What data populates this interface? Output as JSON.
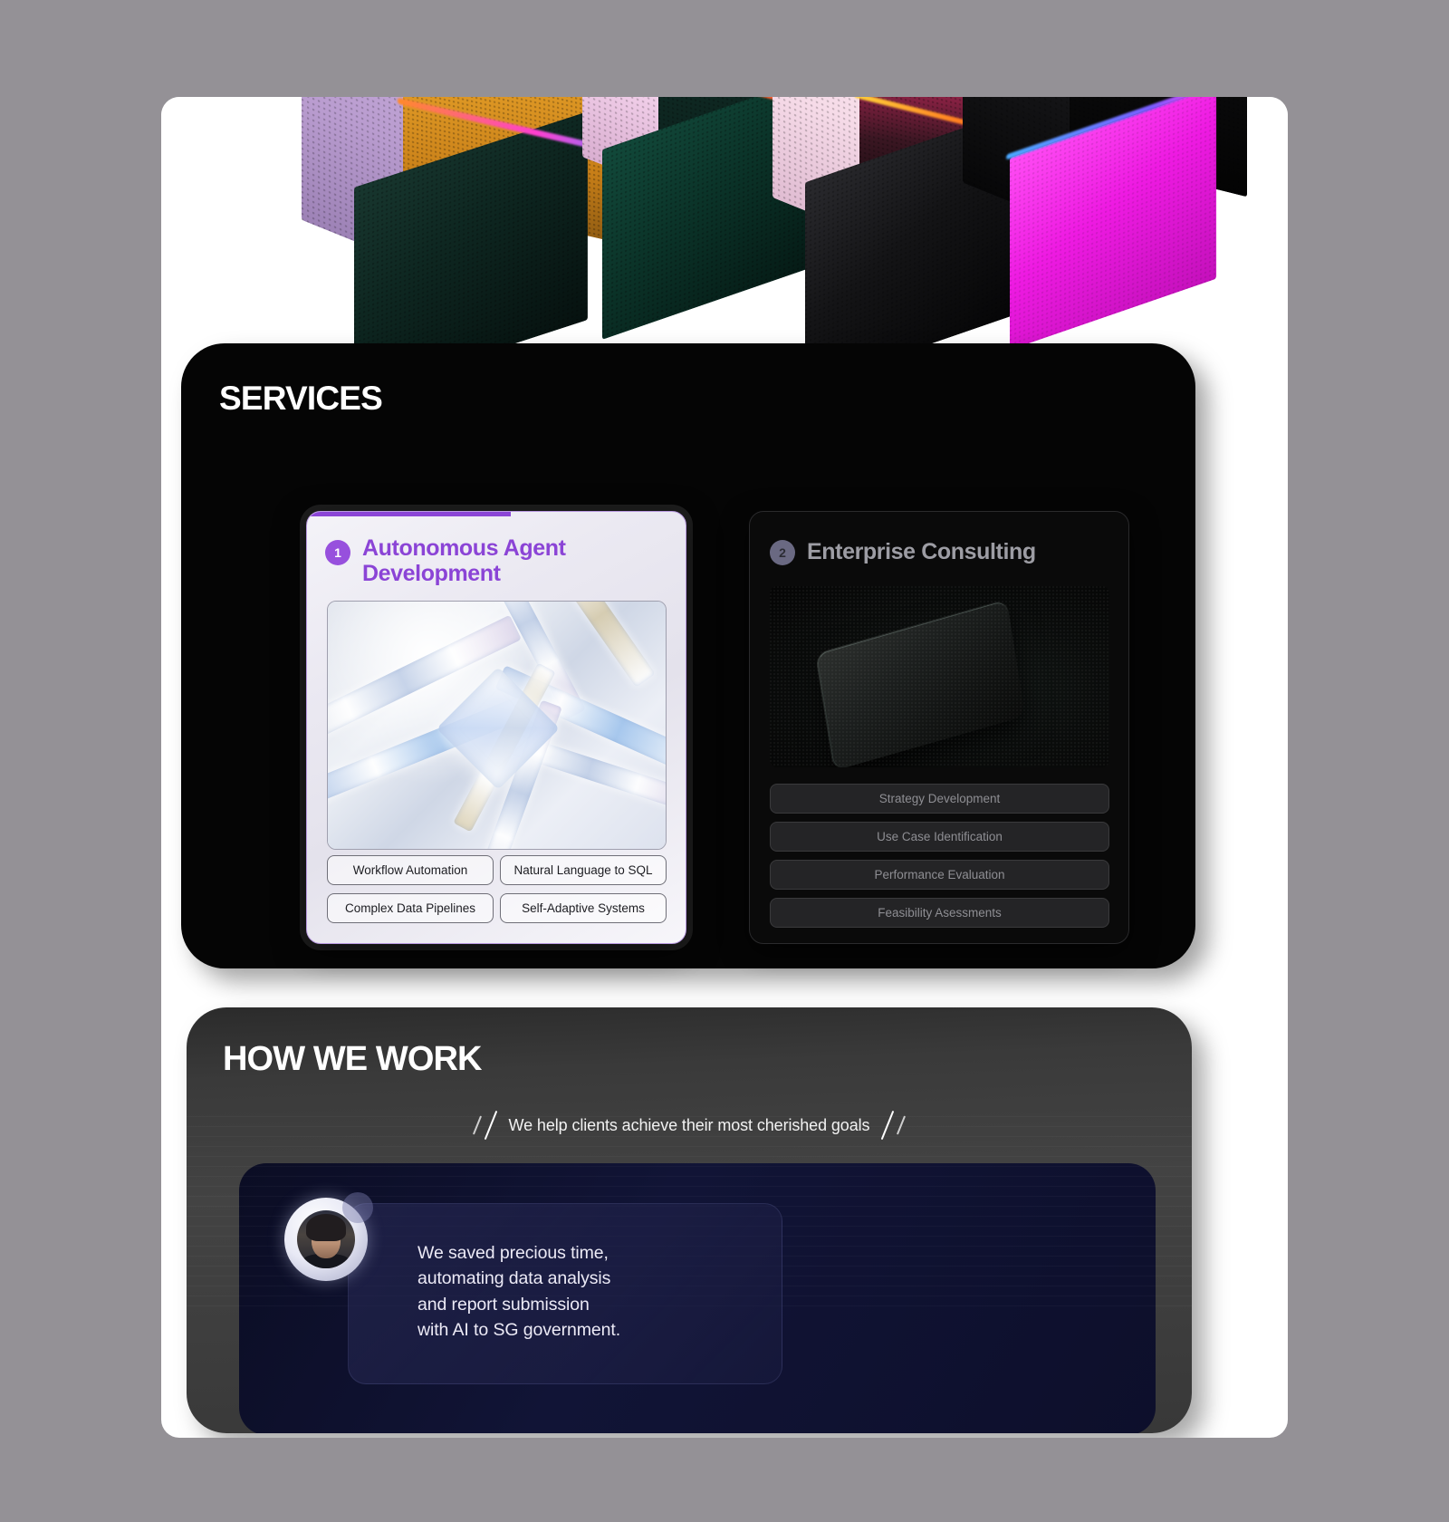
{
  "hero": {
    "alt": "3d-gradient-cubes-render",
    "cubes": [
      {
        "top_face": "#e8a62e",
        "left_face": "#c9a9d8",
        "front_face": "#0d2420"
      },
      {
        "top_face": "#f3d9ec",
        "left_face": "#1f3a33",
        "front_face": "#0c2b25"
      },
      {
        "top_face": "#f0471a",
        "left_face": "#d6456f",
        "front_face": "#120d0d"
      },
      {
        "top_face": "#0c0c0c",
        "left_face": "#101010",
        "front_face": "#e91fe0"
      }
    ]
  },
  "services": {
    "heading": "SERVICES",
    "cards": [
      {
        "number": "1",
        "title": "Autonomous Agent Development",
        "media_alt": "prismatic-glass-lattice-render",
        "tags": [
          "Workflow Automation",
          "Natural Language to SQL",
          "Complex Data Pipelines",
          "Self-Adaptive Systems"
        ]
      },
      {
        "number": "2",
        "title": "Enterprise Consulting",
        "media_alt": "dark-glass-slab-render",
        "tags": [
          "Strategy Development",
          "Use Case Identification",
          "Performance Evaluation",
          "Feasibility Asessments"
        ]
      }
    ]
  },
  "how_we_work": {
    "heading": "HOW WE WORK",
    "tagline": "We help clients achieve their most cherished goals",
    "testimonial": {
      "quote": "We saved precious time,\nautomating data analysis\nand report submission\nwith AI to SG government.",
      "avatar_alt": "client-portrait-avatar"
    }
  },
  "colors": {
    "accent_purple": "#8b44d6",
    "badge_purple": "#9750dd",
    "panel_black": "#050505",
    "panel_grey": "#3e3e3e",
    "testimonial_navy": "#111436",
    "page_bg": "#949196"
  }
}
